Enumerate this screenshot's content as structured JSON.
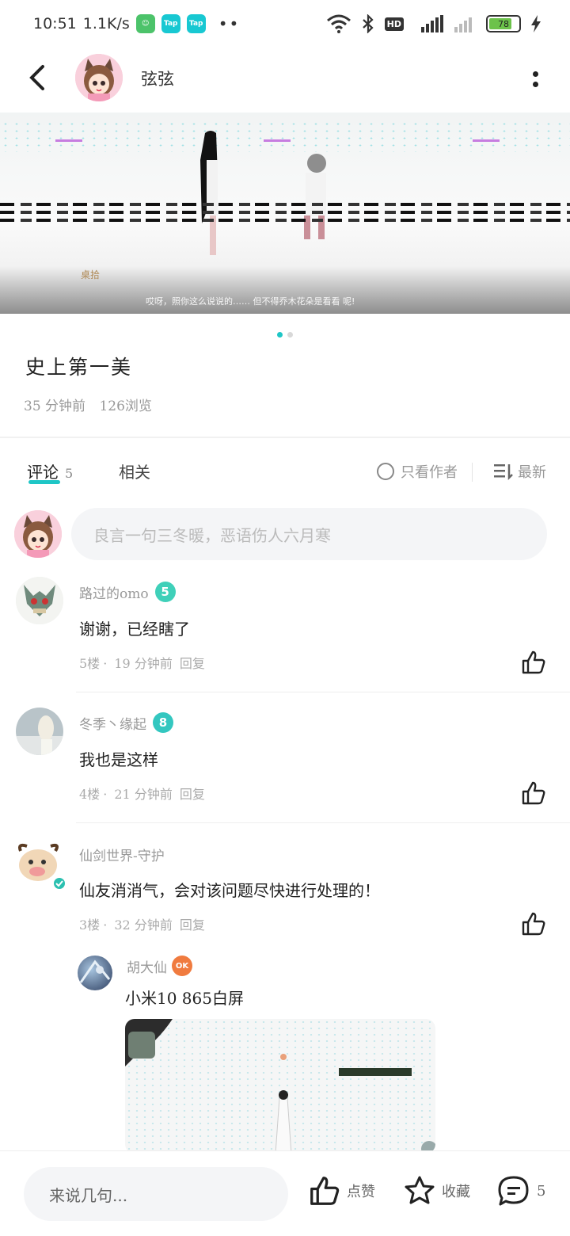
{
  "status_bar": {
    "time": "10:51",
    "net_speed": "1.1K/s",
    "apps": [
      "app-green",
      "Tap",
      "Tap"
    ],
    "battery": "78",
    "battery_level": 0.78
  },
  "header": {
    "author_name": "弦弦"
  },
  "media": {
    "caption": "哎呀，照你这么说说的……  但不得乔木花朵是看看  呢!",
    "watermark": "桌拾",
    "page_count": 2,
    "active_page": 1
  },
  "post": {
    "title": "史上第一美",
    "time_ago": "35 分钟前",
    "views": "126浏览"
  },
  "tabs": {
    "comments_label": "评论",
    "comments_count": "5",
    "related_label": "相关",
    "author_only_label": "只看作者",
    "sort_label": "最新"
  },
  "compose": {
    "placeholder": "良言一句三冬暖，恶语伤人六月寒"
  },
  "comments": [
    {
      "name": "路过的omo",
      "level": "5",
      "level_color": "#3fd0b9",
      "text": "谢谢，已经瞎了",
      "floor": "5楼",
      "time": "19 分钟前",
      "reply": "回复"
    },
    {
      "name": "冬季丶缘起",
      "level": "8",
      "level_color": "#33c7c0",
      "text": "我也是这样",
      "floor": "4楼",
      "time": "21 分钟前",
      "reply": "回复"
    },
    {
      "name": "仙剑世界-守护",
      "text": "仙友消消气，会对该问题尽快进行处理的！",
      "floor": "3楼",
      "time": "32 分钟前",
      "reply": "回复"
    }
  ],
  "reply": {
    "name": "胡大仙",
    "badge": "OK",
    "badge_color": "#f07b3f",
    "text": "小米10 865白屏"
  },
  "bottom_bar": {
    "input_placeholder": "来说几句...",
    "like_label": "点赞",
    "favorite_label": "收藏",
    "comment_count": "5"
  },
  "colors": {
    "accent": "#1ec6c6",
    "muted_text": "#999999"
  }
}
